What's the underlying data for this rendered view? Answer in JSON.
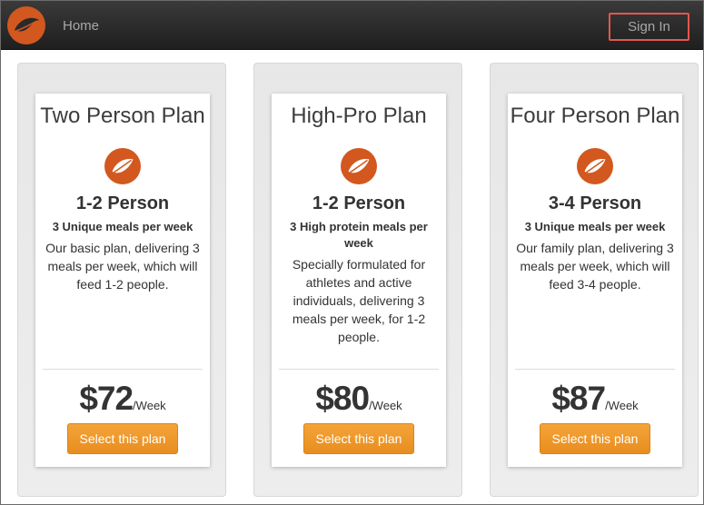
{
  "nav": {
    "home_label": "Home",
    "signin_label": "Sign In",
    "brand_icon": "leaf-logo-icon"
  },
  "colors": {
    "brand_orange": "#d2581f",
    "button_orange": "#ee9a2c",
    "navbar_dark": "#2a2a2a",
    "signin_highlight": "#e4574c"
  },
  "plans": [
    {
      "title": "Two Person Plan",
      "persons": "1-2 Person",
      "meals": "3 Unique meals per week",
      "description": "Our basic plan, delivering 3 meals per week, which will feed 1-2 people.",
      "price": "$72",
      "period": "/Week",
      "button_label": "Select this plan"
    },
    {
      "title": "High-Pro Plan",
      "persons": "1-2 Person",
      "meals": "3 High protein meals per week",
      "description": "Specially formulated for athletes and active individuals, delivering 3 meals per week, for 1-2 people.",
      "price": "$80",
      "period": "/Week",
      "button_label": "Select this plan"
    },
    {
      "title": "Four Person Plan",
      "persons": "3-4 Person",
      "meals": "3 Unique meals per week",
      "description": "Our family plan, delivering 3 meals per week, which will feed 3-4 people.",
      "price": "$87",
      "period": "/Week",
      "button_label": "Select this plan"
    }
  ]
}
